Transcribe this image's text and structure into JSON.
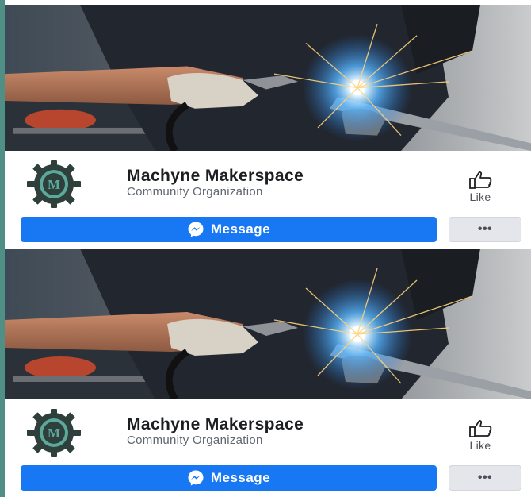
{
  "cards": [
    {
      "page_name": "Machyne Makerspace",
      "category": "Community Organization",
      "logo_letter": "M",
      "like_label": "Like",
      "message_label": "Message",
      "more_label": "•••"
    },
    {
      "page_name": "Machyne Makerspace",
      "category": "Community Organization",
      "logo_letter": "M",
      "like_label": "Like",
      "message_label": "Message",
      "more_label": "•••"
    }
  ],
  "icons": {
    "logo": "gear-logo-icon",
    "like": "thumbs-up-icon",
    "message": "messenger-icon"
  },
  "colors": {
    "brand_blue": "#1877f2",
    "logo_gear": "#2f3f3c",
    "logo_ring": "#5aa99b",
    "page_background": "#4f8f86"
  }
}
